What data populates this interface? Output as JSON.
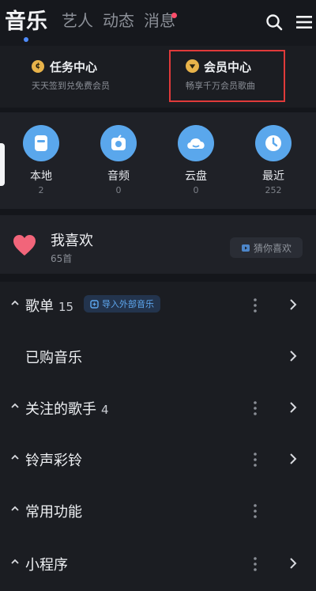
{
  "tabs": [
    {
      "label": "音乐"
    },
    {
      "label": "艺人"
    },
    {
      "label": "动态"
    },
    {
      "label": "消息"
    }
  ],
  "cards": {
    "task": {
      "title": "任务中心",
      "subtitle": "天天签到兑免费会员"
    },
    "vip": {
      "title": "会员中心",
      "subtitle": "畅享千万会员歌曲"
    }
  },
  "quick_access": [
    {
      "label": "本地",
      "count": "2",
      "icon": "phone-icon"
    },
    {
      "label": "音频",
      "count": "0",
      "icon": "radio-icon"
    },
    {
      "label": "云盘",
      "count": "0",
      "icon": "cloud-icon"
    },
    {
      "label": "最近",
      "count": "252",
      "icon": "clock-icon"
    }
  ],
  "favorites": {
    "title": "我喜欢",
    "count": "65首",
    "guess_label": "猜你喜欢"
  },
  "sections": [
    {
      "title": "歌单",
      "count": "15",
      "badge": "导入外部音乐"
    },
    {
      "title": "已购音乐",
      "count": "",
      "badge": ""
    },
    {
      "title": "关注的歌手",
      "count": "4",
      "badge": ""
    },
    {
      "title": "铃声彩铃",
      "count": "",
      "badge": ""
    },
    {
      "title": "常用功能",
      "count": "",
      "badge": ""
    },
    {
      "title": "小程序",
      "count": "",
      "badge": ""
    }
  ],
  "colors": {
    "background": "#14161b",
    "panel": "#1f2127",
    "accent_blue": "#5aa7ec",
    "vip_gold": "#e8b34a",
    "heart": "#f2657a",
    "highlight_border": "#e03a3a"
  }
}
